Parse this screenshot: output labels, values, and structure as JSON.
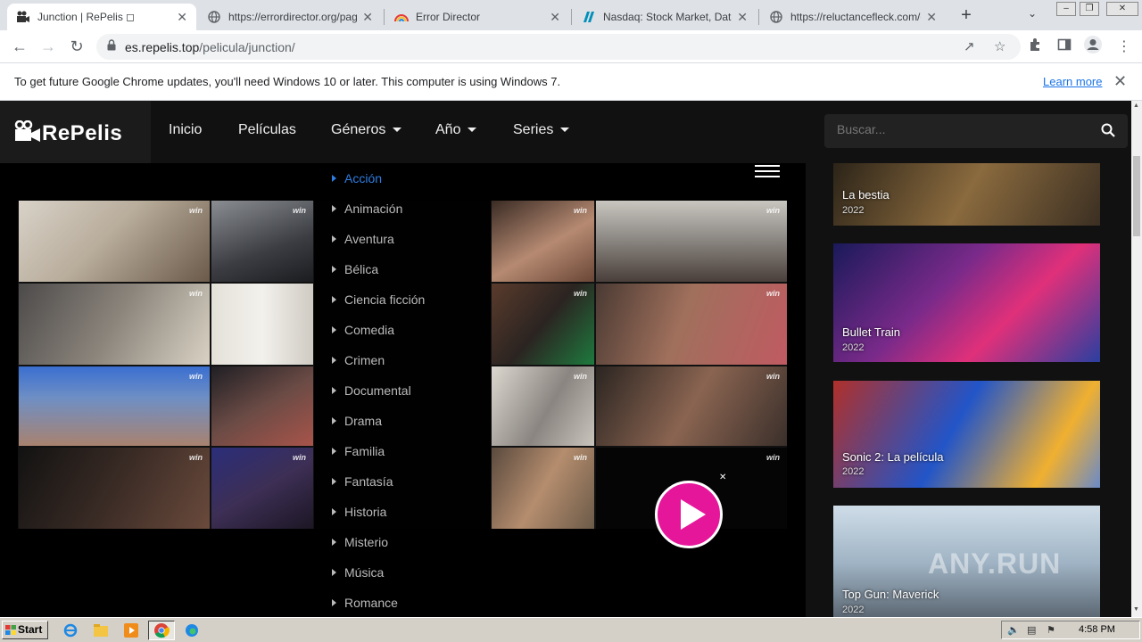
{
  "browser": {
    "tabs": [
      {
        "title": "Junction | RePelis ◻",
        "active": true
      },
      {
        "title": "https://errordirector.org/page",
        "active": false
      },
      {
        "title": "Error Director",
        "active": false
      },
      {
        "title": "Nasdaq: Stock Market, Data U",
        "active": false
      },
      {
        "title": "https://reluctancefleck.com/d",
        "active": false
      }
    ],
    "new_tab": "+",
    "tab_close": "✕",
    "url_domain": "es.repelis.top",
    "url_path": "/pelicula/junction/",
    "infobar": {
      "message": "To get future Google Chrome updates, you'll need Windows 10 or later. This computer is using Windows 7.",
      "learn_more": "Learn more",
      "close": "✕"
    }
  },
  "site": {
    "logo_text": "RePelis",
    "nav": [
      {
        "label": "Inicio",
        "dropdown": false
      },
      {
        "label": "Películas",
        "dropdown": false
      },
      {
        "label": "Géneros",
        "dropdown": true
      },
      {
        "label": "Año",
        "dropdown": true
      },
      {
        "label": "Series",
        "dropdown": true
      }
    ],
    "search_placeholder": "Buscar...",
    "genres": [
      {
        "label": "Acción",
        "active": true
      },
      {
        "label": "Animación",
        "active": false
      },
      {
        "label": "Aventura",
        "active": false
      },
      {
        "label": "Bélica",
        "active": false
      },
      {
        "label": "Ciencia ficción",
        "active": false
      },
      {
        "label": "Comedia",
        "active": false
      },
      {
        "label": "Crimen",
        "active": false
      },
      {
        "label": "Documental",
        "active": false
      },
      {
        "label": "Drama",
        "active": false
      },
      {
        "label": "Familia",
        "active": false
      },
      {
        "label": "Fantasía",
        "active": false
      },
      {
        "label": "Historia",
        "active": false
      },
      {
        "label": "Misterio",
        "active": false
      },
      {
        "label": "Música",
        "active": false
      },
      {
        "label": "Romance",
        "active": false
      }
    ],
    "tile_badge": "win",
    "ad_close": "✕",
    "sidebar_movies": [
      {
        "title": "La bestia",
        "year": "2022"
      },
      {
        "title": "Bullet Train",
        "year": "2022"
      },
      {
        "title": "Sonic 2: La película",
        "year": "2022"
      },
      {
        "title": "Top Gun: Maverick",
        "year": "2022"
      }
    ],
    "watermark": "ANY.RUN",
    "colors": {
      "accent": "#2f7de1",
      "play": "#e6169b"
    }
  },
  "taskbar": {
    "start": "Start",
    "clock": "4:58 PM"
  }
}
